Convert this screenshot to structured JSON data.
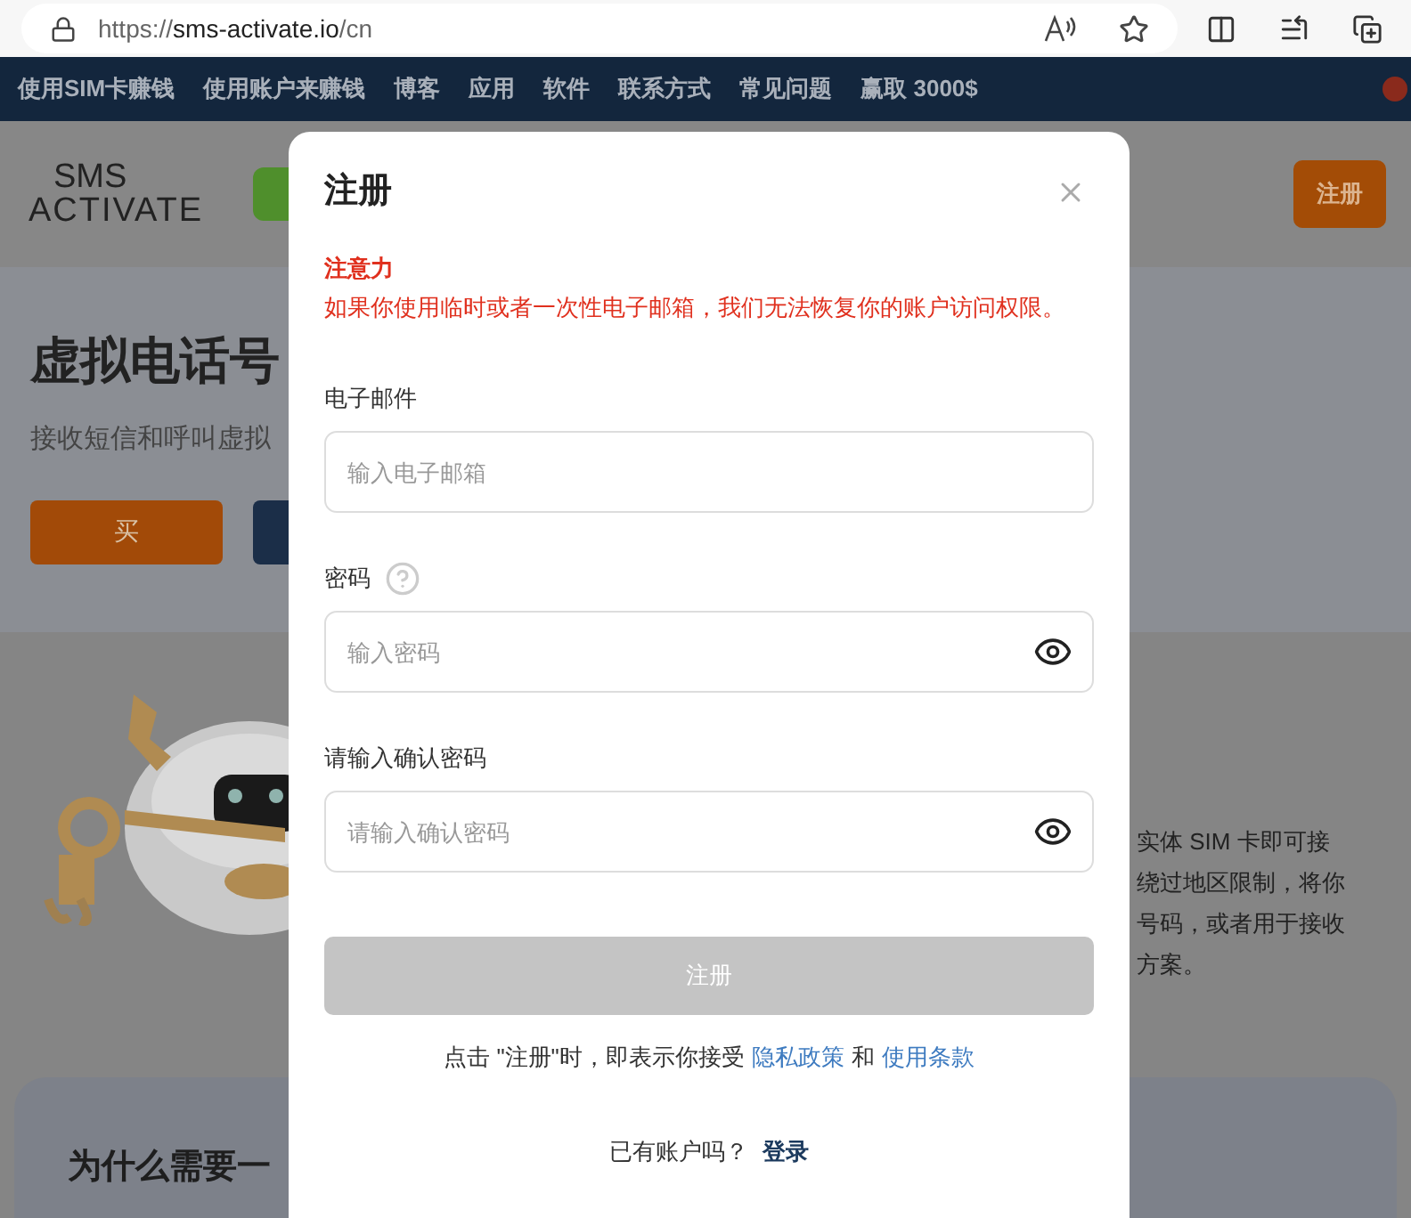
{
  "browser": {
    "url_scheme": "https://",
    "url_host": "sms-activate.io",
    "url_path": "/cn"
  },
  "nav": {
    "items": [
      "使用SIM卡赚钱",
      "使用账户来赚钱",
      "博客",
      "应用",
      "软件",
      "联系方式",
      "常见问题",
      "赢取 3000$"
    ]
  },
  "header": {
    "logo_top": "SMS",
    "logo_bottom": "ACTIVATE",
    "signup_button": "注册"
  },
  "hero": {
    "title": "虚拟电话号",
    "subtitle": "接收短信和呼叫虚拟",
    "buy_button": "买"
  },
  "feature": {
    "lines": [
      "实体 SIM 卡即可接",
      "绕过地区限制，将你",
      "号码，或者用于接收",
      "方案。"
    ]
  },
  "why": {
    "title": "为什么需要一"
  },
  "modal": {
    "title": "注册",
    "warning_title": "注意力",
    "warning_text": "如果你使用临时或者一次性电子邮箱，我们无法恢复你的账户访问权限。",
    "fields": [
      {
        "kind": "email",
        "label": "电子邮件",
        "placeholder": "输入电子邮箱",
        "help": false
      },
      {
        "kind": "password",
        "label": "密码",
        "placeholder": "输入密码",
        "help": true
      },
      {
        "kind": "password",
        "label": "请输入确认密码",
        "placeholder": "请输入确认密码",
        "help": false
      }
    ],
    "submit": {
      "label": "注册",
      "disabled": true
    },
    "terms": {
      "prefix": "点击 \"注册\"时，即表示你接受",
      "privacy": "隐私政策",
      "conjunction": "和",
      "terms": "使用条款"
    },
    "login": {
      "prompt": "已有账户吗？",
      "link": "登录"
    }
  }
}
